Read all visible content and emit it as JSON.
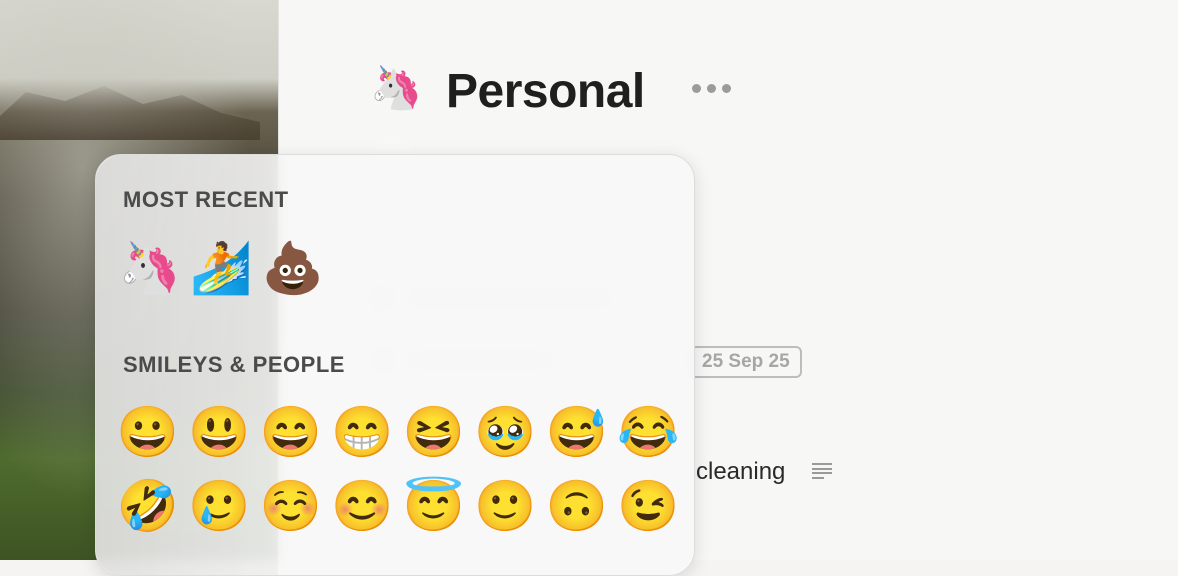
{
  "header": {
    "emoji": "🦄",
    "title": "Personal"
  },
  "background_tasks": {
    "date_tag": "25 Sep 25",
    "task_text": "cleaning"
  },
  "emoji_picker": {
    "sections": [
      {
        "title": "MOST RECENT",
        "emojis": [
          "🦄",
          "🏄",
          "💩"
        ]
      },
      {
        "title": "SMILEYS & PEOPLE",
        "emojis": [
          "😀",
          "😃",
          "😄",
          "😁",
          "😆",
          "🥹",
          "😅",
          "😂",
          "🤣",
          "🥲",
          "☺️",
          "😊",
          "😇",
          "🙂",
          "🙃",
          "😉"
        ]
      }
    ]
  },
  "icons": {
    "more": "more-options-icon",
    "notes": "notes-icon"
  }
}
